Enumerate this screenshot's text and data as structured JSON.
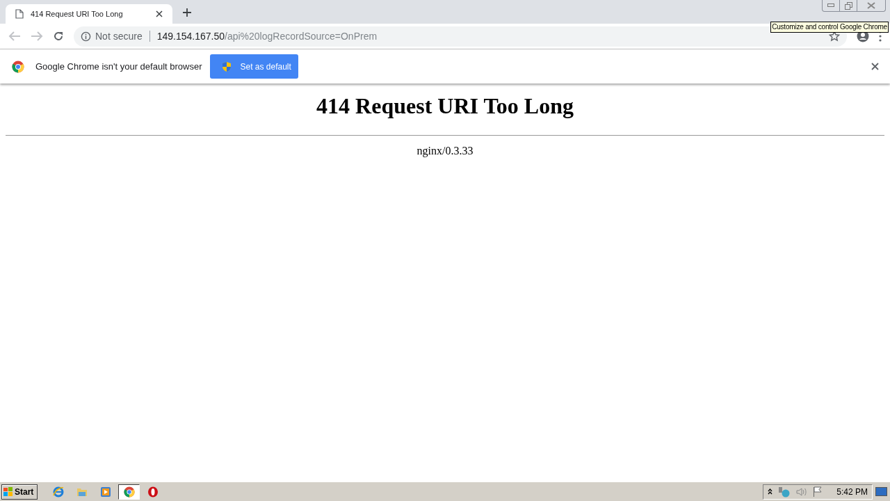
{
  "tab": {
    "title": "414 Request URI Too Long"
  },
  "address_bar": {
    "security": "Not secure",
    "host": "149.154.167.50",
    "path": "/api%20logRecordSource=OnPrem"
  },
  "tooltip": "Customize and control Google Chrome",
  "infobar": {
    "message": "Google Chrome isn't your default browser",
    "button": "Set as default"
  },
  "page": {
    "heading": "414 Request URI Too Long",
    "server": "nginx/0.3.33"
  },
  "taskbar": {
    "start": "Start",
    "apps": [
      {
        "kind": "ie",
        "selected": false
      },
      {
        "kind": "folder",
        "selected": false
      },
      {
        "kind": "media",
        "selected": false
      },
      {
        "kind": "chrome",
        "selected": true
      },
      {
        "kind": "opera",
        "selected": false
      }
    ],
    "clock": "5:42 PM"
  }
}
